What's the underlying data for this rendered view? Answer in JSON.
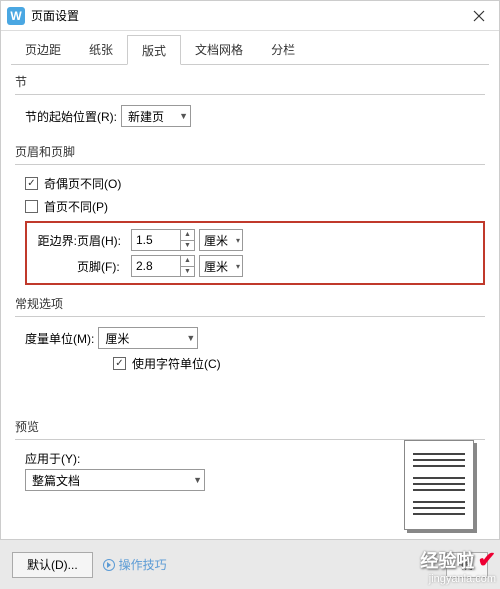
{
  "window": {
    "title": "页面设置",
    "icon_letter": "W"
  },
  "tabs": [
    "页边距",
    "纸张",
    "版式",
    "文档网格",
    "分栏"
  ],
  "active_tab": 2,
  "section": {
    "legend": "节",
    "start_label": "节的起始位置(R):",
    "start_value": "新建页"
  },
  "header_footer": {
    "legend": "页眉和页脚",
    "odd_even_label": "奇偶页不同(O)",
    "odd_even_checked": true,
    "first_page_label": "首页不同(P)",
    "first_page_checked": false,
    "distance": {
      "prefix": "距边界:",
      "header_label": "页眉(H):",
      "header_value": "1.5",
      "footer_label": "页脚(F):",
      "footer_value": "2.8",
      "unit": "厘米"
    }
  },
  "general": {
    "legend": "常规选项",
    "unit_label": "度量单位(M):",
    "unit_value": "厘米",
    "char_unit_label": "使用字符单位(C)",
    "char_unit_checked": true
  },
  "preview": {
    "legend": "预览",
    "apply_label": "应用于(Y):",
    "apply_value": "整篇文档"
  },
  "footer": {
    "default_btn": "默认(D)...",
    "tips": "操作技巧",
    "ok_btn": "确"
  },
  "watermark": {
    "text": "经验啦",
    "url": "jingyanla.com"
  }
}
